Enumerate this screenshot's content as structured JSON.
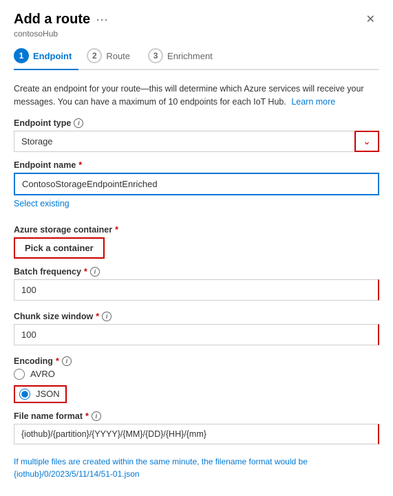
{
  "panel": {
    "title": "Add a route",
    "more_icon": "···",
    "subtitle": "contosoHub",
    "close_label": "✕"
  },
  "steps": [
    {
      "number": "1",
      "label": "Endpoint",
      "active": true
    },
    {
      "number": "2",
      "label": "Route",
      "active": false
    },
    {
      "number": "3",
      "label": "Enrichment",
      "active": false
    }
  ],
  "description": "Create an endpoint for your route—this will determine which Azure services will receive your messages. You can have a maximum of 10 endpoints for each IoT Hub.",
  "learn_more_label": "Learn more",
  "endpoint_type": {
    "label": "Endpoint type",
    "value": "Storage",
    "required": false
  },
  "endpoint_name": {
    "label": "Endpoint name",
    "required_marker": "*",
    "value": "ContosoStorageEndpointEnriched",
    "placeholder": ""
  },
  "select_existing_label": "Select existing",
  "azure_storage": {
    "label": "Azure storage container",
    "required_marker": "*",
    "btn_label": "Pick a container"
  },
  "batch_frequency": {
    "label": "Batch frequency",
    "required_marker": "*",
    "value": "100"
  },
  "chunk_size": {
    "label": "Chunk size window",
    "required_marker": "*",
    "value": "100"
  },
  "encoding": {
    "label": "Encoding",
    "required_marker": "*",
    "options": [
      {
        "value": "AVRO",
        "label": "AVRO",
        "selected": false
      },
      {
        "value": "JSON",
        "label": "JSON",
        "selected": true
      }
    ]
  },
  "file_format": {
    "label": "File name format",
    "required_marker": "*",
    "value": "{iothub}/{partition}/{YYYY}/{MM}/{DD}/{HH}/{mm}"
  },
  "hint": {
    "line1": "If multiple files are created within the same minute, the filename format would be",
    "line2": "{iothub}/0/2023/5/11/14/51-01.json"
  }
}
